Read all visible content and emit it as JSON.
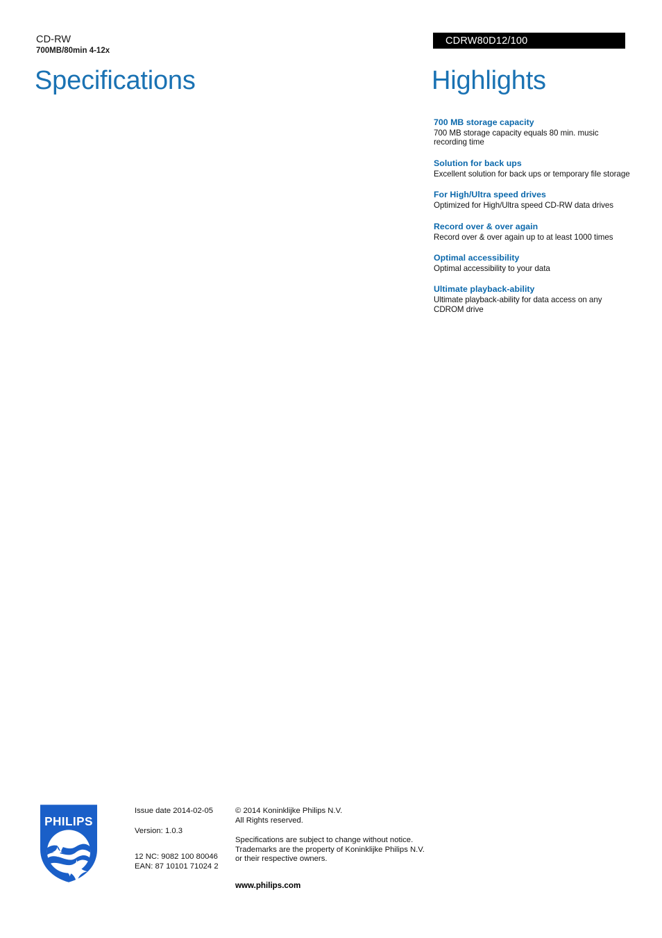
{
  "header": {
    "product_name": "CD-RW",
    "product_subtitle": "700MB/80min 4-12x",
    "model_number": "CDRW80D12/100"
  },
  "sections": {
    "specifications_title": "Specifications",
    "highlights_title": "Highlights"
  },
  "highlights": [
    {
      "title": "700 MB storage capacity",
      "description": "700 MB storage capacity equals 80 min. music recording time"
    },
    {
      "title": "Solution for back ups",
      "description": "Excellent solution for back ups or temporary file storage"
    },
    {
      "title": "For High/Ultra speed drives",
      "description": "Optimized for High/Ultra speed CD-RW data drives"
    },
    {
      "title": "Record over & over again",
      "description": "Record over & over again up to at least 1000 times"
    },
    {
      "title": "Optimal accessibility",
      "description": "Optimal accessibility to your data"
    },
    {
      "title": "Ultimate playback-ability",
      "description": "Ultimate playback-ability for data access on any CDROM drive"
    }
  ],
  "footer": {
    "logo_wordmark": "PHILIPS",
    "issue_date": "Issue date 2014-02-05",
    "version": "Version: 1.0.3",
    "twelve_nc": "12 NC: 9082 100 80046",
    "ean": "EAN: 87 10101 71024 2",
    "copyright_line1": "© 2014 Koninklijke Philips N.V.",
    "copyright_line2": "All Rights reserved.",
    "disclaimer_line1": "Specifications are subject to change without notice.",
    "disclaimer_line2": "Trademarks are the property of Koninklijke Philips N.V.",
    "disclaimer_line3": "or their respective owners.",
    "website": "www.philips.com"
  },
  "colors": {
    "title_blue": "#1a72b3",
    "heading_blue": "#0b68ab",
    "logo_blue": "#1a5fc8",
    "banner_black": "#000000",
    "text_black": "#111111"
  }
}
